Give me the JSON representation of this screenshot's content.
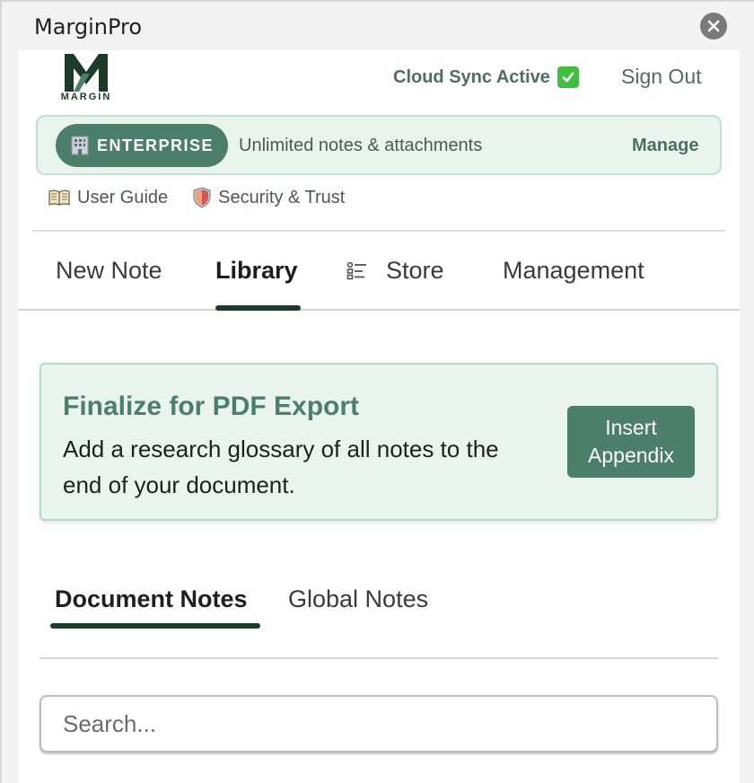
{
  "window": {
    "title": "MarginPro"
  },
  "header": {
    "logo_text": "MARGIN",
    "sync_status": "Cloud Sync Active",
    "sign_out": "Sign Out"
  },
  "plan_banner": {
    "badge_label": "ENTERPRISE",
    "description": "Unlimited notes & attachments",
    "manage_label": "Manage"
  },
  "links": {
    "user_guide": "User Guide",
    "security": "Security & Trust"
  },
  "nav": {
    "tabs": [
      "New Note",
      "Library",
      "Store",
      "Management"
    ],
    "active": "Library"
  },
  "export_card": {
    "title": "Finalize for PDF Export",
    "text": "Add a research glossary of all notes to the end of your document.",
    "button": "Insert Appendix"
  },
  "notes_tabs": {
    "tabs": [
      "Document Notes",
      "Global Notes"
    ],
    "active": "Document Notes"
  },
  "search": {
    "placeholder": "Search..."
  },
  "colors": {
    "accent": "#4b7e6b",
    "dark_green": "#1e3a28",
    "banner_bg": "#e9f4ef",
    "sync_check": "#3fbf3f"
  }
}
